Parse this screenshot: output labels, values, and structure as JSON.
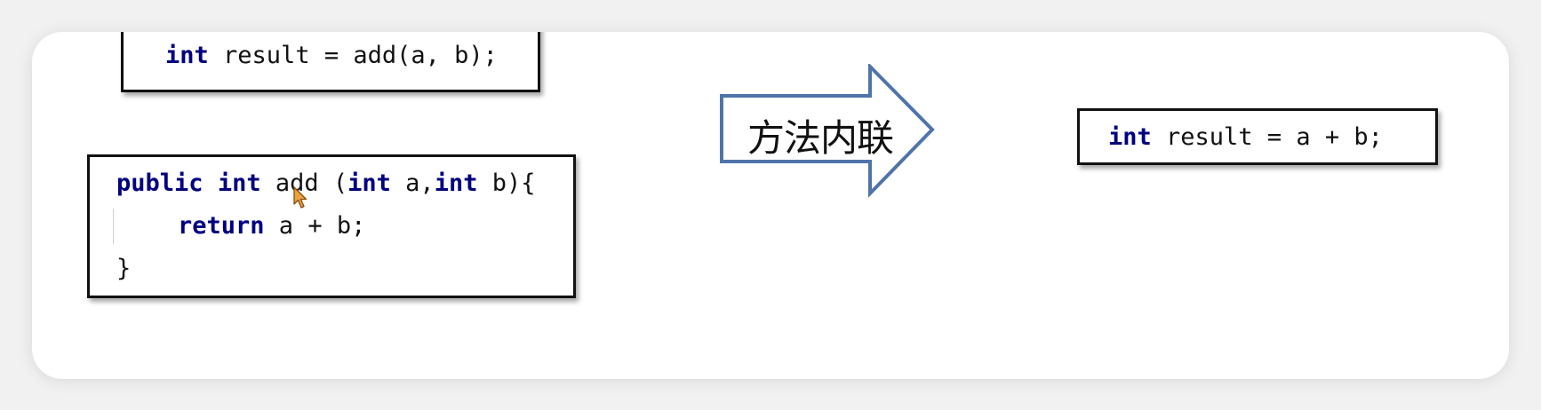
{
  "code_call": {
    "kw_int": "int",
    "rest": " result = add(a, b);"
  },
  "code_method": {
    "line1_kw_public": "public",
    "line1_kw_int1": "int",
    "line1_mid": " add (",
    "line1_kw_int2": "int",
    "line1_mid2": " a,",
    "line1_kw_int3": "int",
    "line1_end": " b){",
    "line2_kw_return": "return",
    "line2_rest": " a + b;",
    "line3": "}"
  },
  "arrow": {
    "label": "方法内联",
    "stroke_color": "#4f74aa"
  },
  "code_result": {
    "kw_int": "int",
    "rest": " result = a + b;"
  },
  "colors": {
    "keyword": "#000080",
    "text": "#111111",
    "cursor": "#c87a1a"
  }
}
